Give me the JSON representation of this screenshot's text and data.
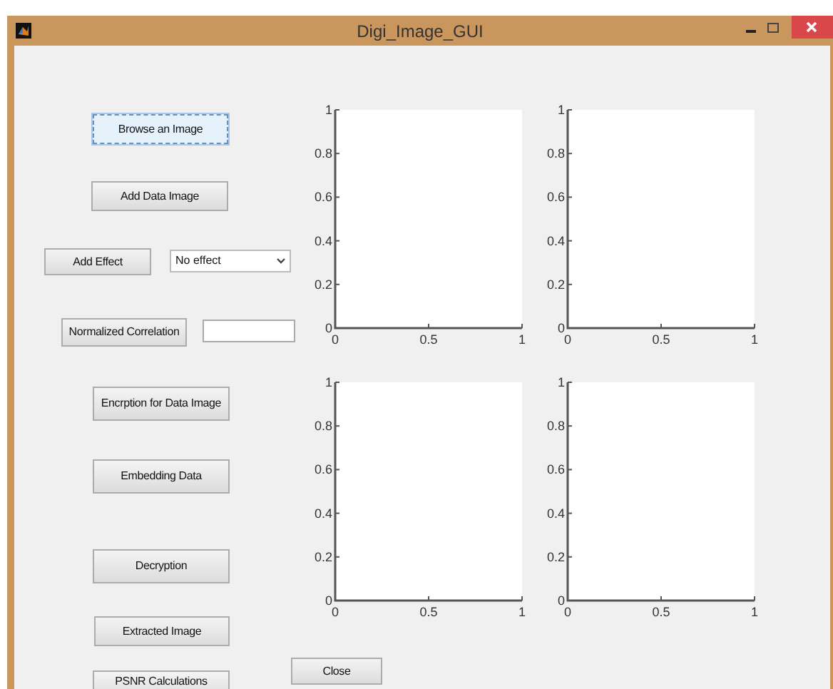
{
  "window": {
    "title": "Digi_Image_GUI"
  },
  "controls": [
    {
      "kind": "button",
      "label": "Browse an Image",
      "focused": true
    },
    {
      "kind": "button",
      "label": "Add Data Image",
      "focused": false
    },
    {
      "kind": "button",
      "label": "Add Effect",
      "focused": false
    },
    {
      "kind": "dropdown",
      "value": "No effect"
    },
    {
      "kind": "button",
      "label": "Normalized Correlation",
      "focused": false
    },
    {
      "kind": "field"
    },
    {
      "kind": "button",
      "label": "Encrption for Data Image",
      "focused": false
    },
    {
      "kind": "button",
      "label": "Embedding Data",
      "focused": false
    },
    {
      "kind": "button",
      "label": "Decryption",
      "focused": false
    },
    {
      "kind": "button",
      "label": "Extracted Image",
      "focused": false
    },
    {
      "kind": "button",
      "label": "PSNR Calculations",
      "focused": false
    },
    {
      "kind": "button",
      "label": "Close",
      "focused": false
    }
  ],
  "axes": [
    {
      "chart_data": {
        "type": "line",
        "xlim": [
          0,
          1
        ],
        "ylim": [
          0,
          1
        ],
        "xticks": [
          0,
          0.5,
          1
        ],
        "yticks": [
          0,
          0.2,
          0.4,
          0.6,
          0.8,
          1
        ]
      }
    },
    {
      "chart_data": {
        "type": "line",
        "xlim": [
          0,
          1
        ],
        "ylim": [
          0,
          1
        ],
        "xticks": [
          0,
          0.5,
          1
        ],
        "yticks": [
          0,
          0.2,
          0.4,
          0.6,
          0.8,
          1
        ]
      }
    },
    {
      "chart_data": {
        "type": "line",
        "xlim": [
          0,
          1
        ],
        "ylim": [
          0,
          1
        ],
        "xticks": [
          0,
          0.5,
          1
        ],
        "yticks": [
          0,
          0.2,
          0.4,
          0.6,
          0.8,
          1
        ]
      }
    },
    {
      "chart_data": {
        "type": "line",
        "xlim": [
          0,
          1
        ],
        "ylim": [
          0,
          1
        ],
        "xticks": [
          0,
          0.5,
          1
        ],
        "yticks": [
          0,
          0.2,
          0.4,
          0.6,
          0.8,
          1
        ]
      }
    }
  ]
}
